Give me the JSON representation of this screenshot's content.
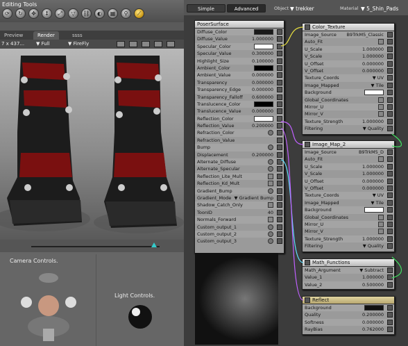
{
  "app": {
    "title": "Editing Tools"
  },
  "left": {
    "tabs": [
      "Preview",
      "Render",
      "ssss"
    ],
    "viewbar": {
      "size": "7 x 437...",
      "fit": "▼ Full",
      "renderer": "▼ FireFly"
    },
    "camera_label": "Camera Controls.",
    "light_label": "Light Controls."
  },
  "right": {
    "tabs": [
      "Simple",
      "Advanced"
    ],
    "object_label": "Object",
    "object_value": "▼ trekker",
    "material_label": "Material",
    "material_value": "▼ 5_Shin_Pads"
  },
  "poser": {
    "title": "PoserSurface",
    "rows": [
      {
        "label": "Diffuse_Color",
        "kind": "swatch",
        "color": "#1a1a1a"
      },
      {
        "label": "Diffuse_Value",
        "kind": "value",
        "value": "1.000000"
      },
      {
        "label": "Specular_Color",
        "kind": "swatch",
        "color": "#ffffff"
      },
      {
        "label": "Specular_Value",
        "kind": "value",
        "value": "0.300000"
      },
      {
        "label": "Highlight_Size",
        "kind": "value",
        "value": "0.100000"
      },
      {
        "label": "Ambient_Color",
        "kind": "swatch",
        "color": "#000000"
      },
      {
        "label": "Ambient_Value",
        "kind": "value",
        "value": "0.000000"
      },
      {
        "label": "Transparency",
        "kind": "value",
        "value": "0.000000"
      },
      {
        "label": "Transparency_Edge",
        "kind": "value",
        "value": "0.000000"
      },
      {
        "label": "Transparency_Falloff",
        "kind": "value",
        "value": "0.600000"
      },
      {
        "label": "Translucence_Color",
        "kind": "swatch",
        "color": "#000000"
      },
      {
        "label": "Translucence_Value",
        "kind": "value",
        "value": "0.000000"
      },
      {
        "label": "Reflection_Color",
        "kind": "swatch",
        "color": "#ffffff"
      },
      {
        "label": "Reflection_Value",
        "kind": "value",
        "value": "0.200000"
      },
      {
        "label": "Refraction_Color",
        "kind": "sub",
        "value": ""
      },
      {
        "label": "Refraction_Value",
        "kind": "value",
        "value": ""
      },
      {
        "label": "Bump",
        "kind": "sub",
        "value": ""
      },
      {
        "label": "Displacement",
        "kind": "value",
        "value": "0.200000"
      },
      {
        "label": "Alternate_Diffuse",
        "kind": "sub",
        "value": ""
      },
      {
        "label": "Alternate_Specular",
        "kind": "sub",
        "value": ""
      },
      {
        "label": "Reflection_Lite_Mult",
        "kind": "check",
        "value": ""
      },
      {
        "label": "Reflection_Kd_Mult",
        "kind": "check",
        "value": ""
      },
      {
        "label": "Gradient_Bump",
        "kind": "sub",
        "value": ""
      },
      {
        "label": "Gradient_Mode",
        "kind": "value",
        "value": "▼ Gradient Bump"
      },
      {
        "label": "Shadow_Catch_Only",
        "kind": "check",
        "value": ""
      },
      {
        "label": "ToonID",
        "kind": "value",
        "value": "40"
      },
      {
        "label": "Normals_Forward",
        "kind": "check",
        "value": ""
      },
      {
        "label": "Custom_output_1",
        "kind": "sub",
        "value": ""
      },
      {
        "label": "Custom_output_2",
        "kind": "sub",
        "value": ""
      },
      {
        "label": "Custom_output_3",
        "kind": "sub",
        "value": ""
      }
    ]
  },
  "color_texture": {
    "title": "Color_Texture",
    "rows": [
      {
        "label": "Image_Source",
        "value": "B9TrkM5_Classic"
      },
      {
        "label": "Auto_Fit",
        "value": ""
      },
      {
        "label": "U_Scale",
        "value": "1.000000"
      },
      {
        "label": "V_Scale",
        "value": "1.000000"
      },
      {
        "label": "U_Offset",
        "value": "0.000000"
      },
      {
        "label": "V_Offset",
        "value": "0.000000"
      },
      {
        "label": "Texture_Coords",
        "value": "▼ UV"
      },
      {
        "label": "Image_Mapped",
        "value": "▼ Tile"
      },
      {
        "label": "Background",
        "value": ""
      },
      {
        "label": "Global_Coordinates",
        "value": ""
      },
      {
        "label": "Mirror_U",
        "value": ""
      },
      {
        "label": "Mirror_V",
        "value": ""
      },
      {
        "label": "Texture_Strength",
        "value": "1.000000"
      },
      {
        "label": "Filtering",
        "value": "▼ Quality"
      }
    ]
  },
  "image_map": {
    "title": "Image_Map_2",
    "rows": [
      {
        "label": "Image_Source",
        "value": "B9TrkM5_D"
      },
      {
        "label": "Auto_Fit",
        "value": ""
      },
      {
        "label": "U_Scale",
        "value": "1.000000"
      },
      {
        "label": "V_Scale",
        "value": "1.000000"
      },
      {
        "label": "U_Offset",
        "value": "0.000000"
      },
      {
        "label": "V_Offset",
        "value": "0.000000"
      },
      {
        "label": "Texture_Coords",
        "value": "▼ UV"
      },
      {
        "label": "Image_Mapped",
        "value": "▼ Tile"
      },
      {
        "label": "Background",
        "value": ""
      },
      {
        "label": "Global_Coordinates",
        "value": ""
      },
      {
        "label": "Mirror_U",
        "value": ""
      },
      {
        "label": "Mirror_V",
        "value": ""
      },
      {
        "label": "Texture_Strength",
        "value": "1.000000"
      },
      {
        "label": "Filtering",
        "value": "▼ Quality"
      }
    ]
  },
  "math": {
    "title": "Math_Functions",
    "rows": [
      {
        "label": "Math_Argument",
        "value": "▼ Subtract"
      },
      {
        "label": "Value_1",
        "value": "1.000000"
      },
      {
        "label": "Value_2",
        "value": "0.500000"
      }
    ]
  },
  "reflect": {
    "title": "Reflect",
    "rows": [
      {
        "label": "Background",
        "value": ""
      },
      {
        "label": "Quality",
        "value": "0.200000"
      },
      {
        "label": "Softness",
        "value": "0.000000"
      },
      {
        "label": "RayBias",
        "value": "0.762000"
      }
    ]
  }
}
